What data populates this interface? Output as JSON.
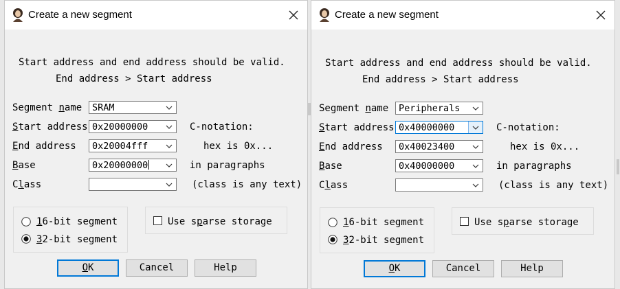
{
  "dialogs": [
    {
      "title": "Create a new segment",
      "message_line1": "Start address and end address should be valid.",
      "message_line2": "End address > Start address",
      "fields": {
        "segment_name": {
          "label_pre": "Segment ",
          "label_u": "n",
          "label_post": "ame",
          "value": "SRAM"
        },
        "start_address": {
          "label_pre": "",
          "label_u": "S",
          "label_post": "tart address",
          "value": "0x20000000"
        },
        "end_address": {
          "label_pre": "",
          "label_u": "E",
          "label_post": "nd address",
          "value": "0x20004fff"
        },
        "base": {
          "label_pre": "",
          "label_u": "B",
          "label_post": "ase",
          "value": "0x20000000"
        },
        "class": {
          "label_pre": "C",
          "label_u": "l",
          "label_post": "ass",
          "value": ""
        }
      },
      "hints": {
        "c_notation": "C-notation:",
        "hex": "hex is 0x...",
        "paragraphs": "in paragraphs",
        "class_hint": "(class is any text)"
      },
      "radio_16": {
        "u": "1",
        "rest": "6-bit segment",
        "checked": false
      },
      "radio_32": {
        "u": "3",
        "rest": "2-bit segment",
        "checked": true
      },
      "sparse": {
        "pre": "Use s",
        "u": "p",
        "post": "arse storage",
        "checked": false
      },
      "buttons": {
        "ok_u": "O",
        "ok_rest": "K",
        "cancel": "Cancel",
        "help": "Help"
      }
    },
    {
      "title": "Create a new segment",
      "message_line1": "Start address and end address should be valid.",
      "message_line2": "End address > Start address",
      "fields": {
        "segment_name": {
          "label_pre": "Segment ",
          "label_u": "n",
          "label_post": "ame",
          "value": "Peripherals"
        },
        "start_address": {
          "label_pre": "",
          "label_u": "S",
          "label_post": "tart address",
          "value": "0x40000000"
        },
        "end_address": {
          "label_pre": "",
          "label_u": "E",
          "label_post": "nd address",
          "value": "0x40023400"
        },
        "base": {
          "label_pre": "",
          "label_u": "B",
          "label_post": "ase",
          "value": "0x40000000"
        },
        "class": {
          "label_pre": "C",
          "label_u": "l",
          "label_post": "ass",
          "value": ""
        }
      },
      "hints": {
        "c_notation": "C-notation:",
        "hex": "hex is 0x...",
        "paragraphs": "in paragraphs",
        "class_hint": "(class is any text)"
      },
      "radio_16": {
        "u": "1",
        "rest": "6-bit segment",
        "checked": false
      },
      "radio_32": {
        "u": "3",
        "rest": "2-bit segment",
        "checked": true
      },
      "sparse": {
        "pre": "Use s",
        "u": "p",
        "post": "arse storage",
        "checked": false
      },
      "buttons": {
        "ok_u": "O",
        "ok_rest": "K",
        "cancel": "Cancel",
        "help": "Help"
      }
    }
  ],
  "colors": {
    "accent": "#0078d7",
    "dialog_bg": "#f0f0f0",
    "title_bg": "#ffffff"
  }
}
